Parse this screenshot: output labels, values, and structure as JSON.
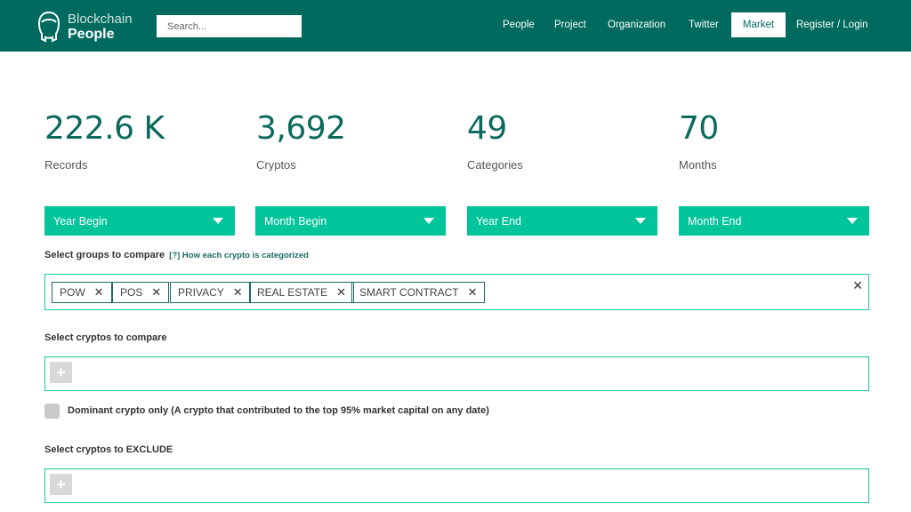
{
  "header": {
    "logo_line1": "Blockchain",
    "logo_line2": "People",
    "search_placeholder": "Search...",
    "nav": [
      "People",
      "Project",
      "Organization",
      "Twitter",
      "Market",
      "Register / Login"
    ],
    "active_nav": "Market"
  },
  "stats": [
    {
      "value": "222.6 K",
      "label": "Records"
    },
    {
      "value": "3,692",
      "label": "Cryptos"
    },
    {
      "value": "49",
      "label": "Categories"
    },
    {
      "value": "70",
      "label": "Months"
    }
  ],
  "filters": [
    "Year Begin",
    "Month Begin",
    "Year End",
    "Month End"
  ],
  "groups": {
    "label": "Select groups to compare",
    "help_link": "[?] How each crypto is categorized",
    "tags": [
      "POW",
      "POS",
      "PRIVACY",
      "REAL ESTATE",
      "SMART CONTRACT"
    ],
    "tag_remove_glyph": "✕",
    "clear_glyph": "✕"
  },
  "compare": {
    "label": "Select cryptos to compare",
    "add_glyph": "+"
  },
  "dominant": {
    "label": "Dominant crypto only (A crypto that contributed to the top 95% market capital on any date)"
  },
  "exclude": {
    "label": "Select cryptos to EXCLUDE",
    "add_glyph": "+"
  },
  "colors": {
    "header_bg": "#006a5e",
    "accent": "#00c49a",
    "stat_text": "#0b6a5e"
  }
}
